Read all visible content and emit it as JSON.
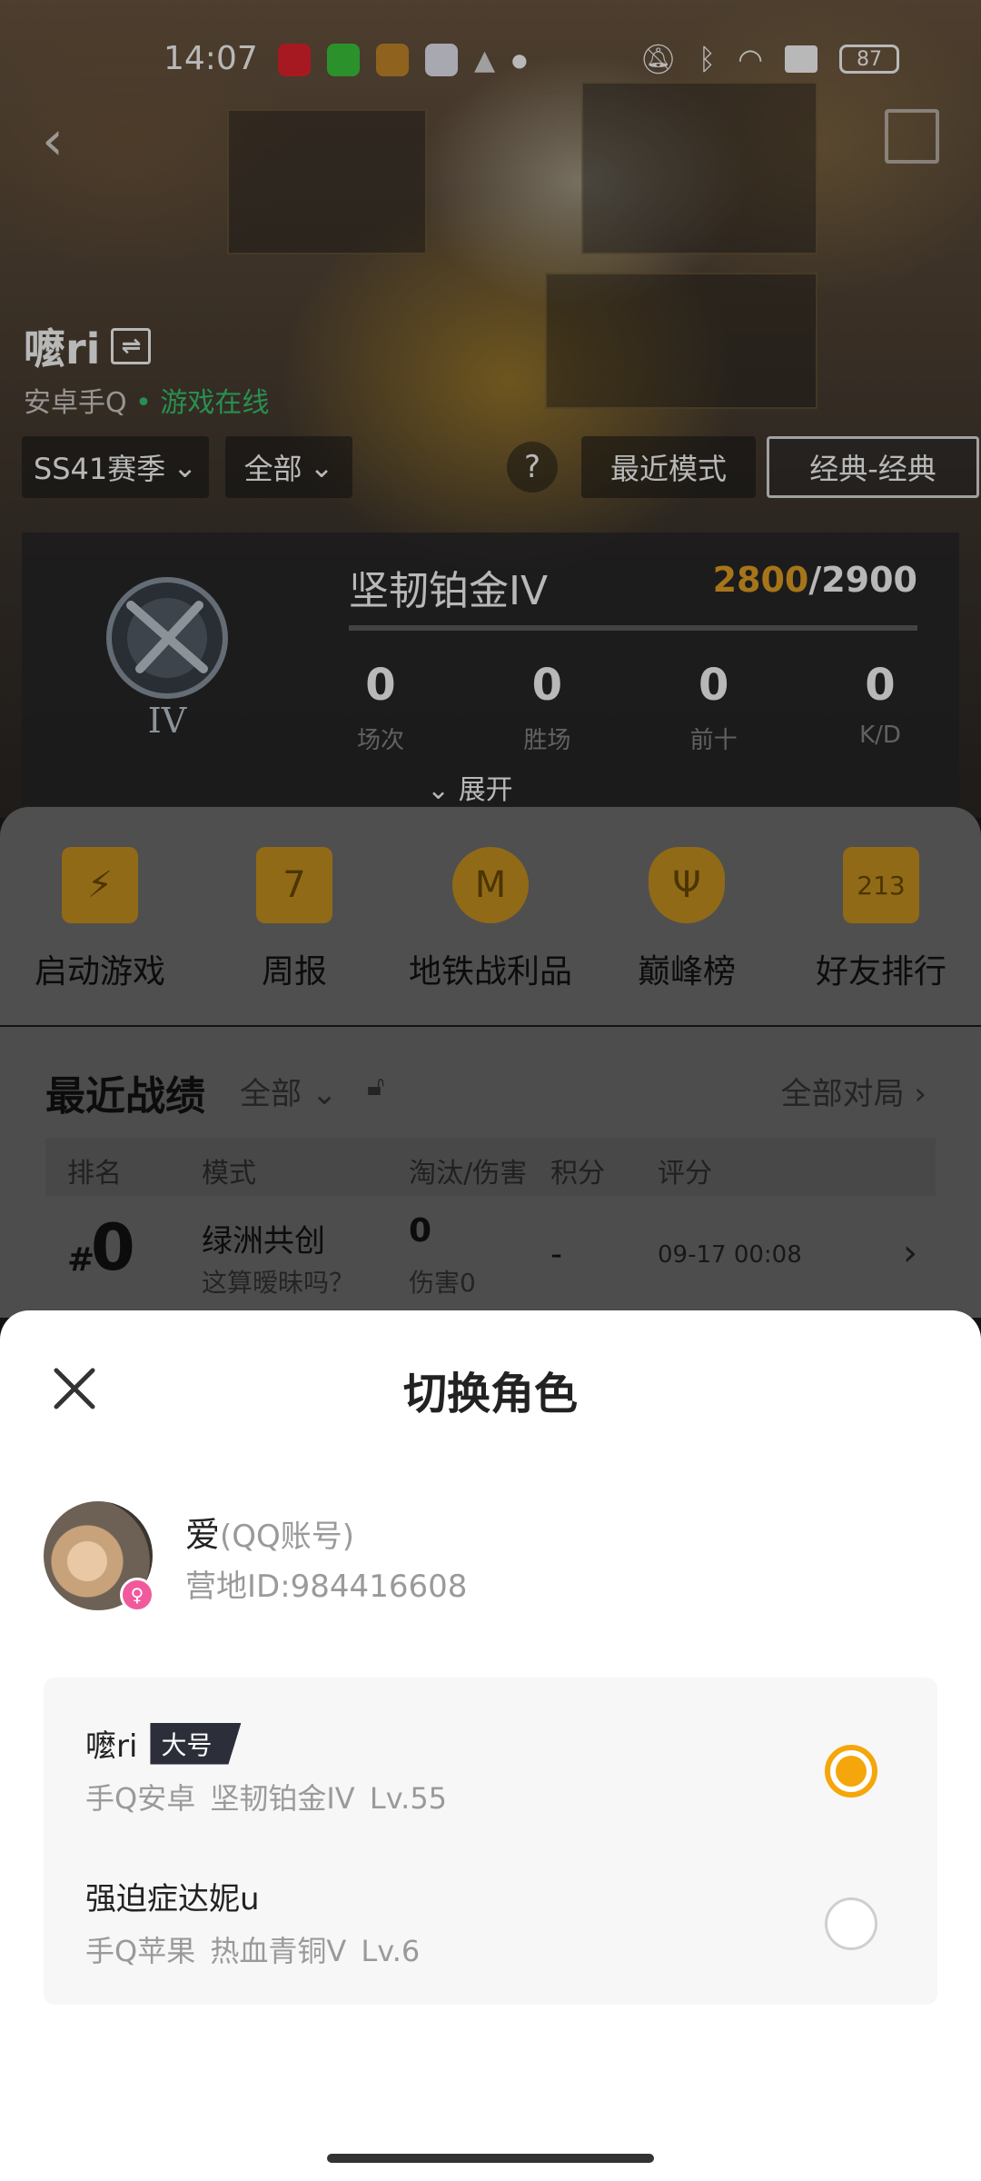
{
  "status_bar": {
    "time": "14:07",
    "battery": "87",
    "icons": [
      "music-app-icon",
      "wechat-icon",
      "game-app-icon",
      "photo-app-icon",
      "android-icon",
      "dot-icon",
      "mute-icon",
      "bluetooth-icon",
      "wifi-icon",
      "sim-off-icon"
    ]
  },
  "profile": {
    "name": "嚒ri",
    "switch_glyph": "⇌",
    "platform": "安卓手Q",
    "online_dot": "•",
    "status": "游戏在线"
  },
  "filters": {
    "season": "SS41赛季",
    "range": "全部",
    "help": "?",
    "mode_label": "最近模式",
    "mode_value": "经典-经典"
  },
  "rank": {
    "emblem_level": "IV",
    "title": "坚韧铂金IV",
    "points_current": "2800",
    "points_sep": "/",
    "points_max": "2900",
    "progress": 0.0,
    "stats": [
      {
        "value": "0",
        "label": "场次"
      },
      {
        "value": "0",
        "label": "胜场"
      },
      {
        "value": "0",
        "label": "前十"
      },
      {
        "value": "0",
        "label": "K/D"
      }
    ],
    "expand": "展开"
  },
  "quick_actions": [
    {
      "label": "启动游戏",
      "icon": "lightning-icon"
    },
    {
      "label": "周报",
      "icon": "calendar-icon",
      "badge": "7"
    },
    {
      "label": "地铁战利品",
      "icon": "metro-loot-icon",
      "badge": "M"
    },
    {
      "label": "巅峰榜",
      "icon": "peak-shield-icon"
    },
    {
      "label": "好友排行",
      "icon": "podium-icon",
      "badge": "213"
    }
  ],
  "records": {
    "title": "最近战绩",
    "filter": "全部",
    "all_matches": "全部对局",
    "columns": [
      "排名",
      "模式",
      "淘汰/伤害",
      "积分",
      "评分"
    ],
    "rows": [
      {
        "rank_prefix": "#",
        "rank": "0",
        "mode": "绿洲共创",
        "subtitle": "这算暧昧吗？",
        "kills": "0",
        "damage": "伤害0",
        "score": "-",
        "time": "09-17 00:08"
      }
    ]
  },
  "sheet": {
    "title": "切换角色",
    "account": {
      "name": "爱",
      "tag": "(QQ账号)",
      "id": "营地ID:984416608"
    },
    "roles": [
      {
        "name": "嚒ri",
        "badge": "大号",
        "detail": "手Q安卓  坚韧铂金IV  Lv.55",
        "selected": true
      },
      {
        "name": "强迫症达妮u",
        "badge": "",
        "detail": "手Q苹果  热血青铜V  Lv.6",
        "selected": false
      }
    ]
  },
  "colors": {
    "accent": "#f5a60a",
    "points": "#e7a323",
    "online": "#39c76f",
    "badge_bg": "#2c2f3a",
    "gender": "#f05a9c"
  }
}
